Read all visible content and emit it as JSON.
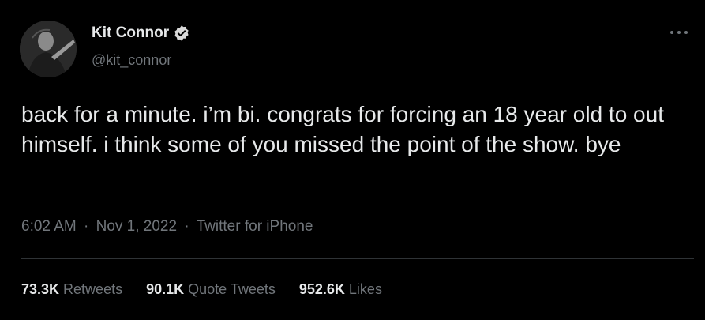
{
  "author": {
    "display_name": "Kit Connor",
    "handle": "@kit_connor",
    "avatar_icon": "profile-photo",
    "verified_icon": "verified-badge-icon"
  },
  "tweet": {
    "text": "back for a minute. i’m bi. congrats for forcing an 18 year old to out himself. i think some of you missed the point of the show. bye",
    "time": "6:02 AM",
    "date": "Nov 1, 2022",
    "source": "Twitter for iPhone",
    "separator": "·"
  },
  "stats": {
    "retweets": {
      "count": "73.3K",
      "label": "Retweets"
    },
    "quote_tweets": {
      "count": "90.1K",
      "label": "Quote Tweets"
    },
    "likes": {
      "count": "952.6K",
      "label": "Likes"
    }
  },
  "colors": {
    "background": "#000000",
    "primary_text": "#e7e9ea",
    "secondary_text": "#71767b",
    "divider": "#2f3336",
    "verified": "#d9d9d9"
  }
}
